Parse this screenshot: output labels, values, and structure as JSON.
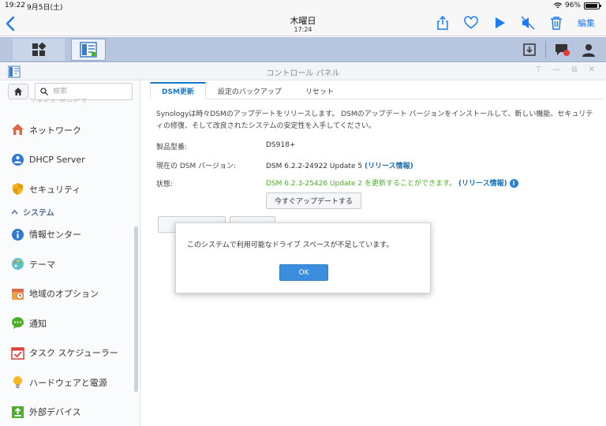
{
  "status_bar": {
    "time": "19:22",
    "date": "9月5日(土)",
    "battery": "96%"
  },
  "nav": {
    "title": "木曜日",
    "subtitle": "17:24",
    "edit_label": "編集"
  },
  "window": {
    "title": "コントロール パネル"
  },
  "sidebar": {
    "search_placeholder": "検索",
    "cut_item": "ファイル サービス",
    "items": [
      {
        "label": "ネットワーク",
        "icon": "house-network-icon"
      },
      {
        "label": "DHCP Server",
        "icon": "dhcp-icon"
      },
      {
        "label": "セキュリティ",
        "icon": "shield-icon"
      }
    ],
    "section": "システム",
    "system_items": [
      {
        "label": "情報センター",
        "icon": "info-icon"
      },
      {
        "label": "テーマ",
        "icon": "palette-icon"
      },
      {
        "label": "地域のオプション",
        "icon": "clock-calendar-icon"
      },
      {
        "label": "通知",
        "icon": "chat-bubble-icon"
      },
      {
        "label": "タスク スケジューラー",
        "icon": "calendar-check-icon"
      },
      {
        "label": "ハードウェアと電源",
        "icon": "lightbulb-icon"
      },
      {
        "label": "外部デバイス",
        "icon": "external-device-icon"
      }
    ]
  },
  "tabs": [
    "DSM更新",
    "設定のバックアップ",
    "リセット"
  ],
  "content": {
    "description": "Synologyは時々DSMのアップデートをリリースします。 DSMのアップデート バージョンをインストールして、新しい機能、セキュリティの修復、そして改良されたシステムの安定性を入手してください。",
    "model_label": "製品型番:",
    "model_value": "DS918+",
    "version_label": "現在の DSM バージョン:",
    "version_value": "DSM 6.2.2-24922 Update 5",
    "release_notes": "(リリース情報)",
    "status_label": "状態:",
    "status_value": "DSM 6.2.3-25426 Update 2 を更新することができます。",
    "update_button": "今すぐアップデートする"
  },
  "modal": {
    "message": "このシステムで利用可能なドライブ スペースが不足しています。",
    "ok": "OK"
  },
  "colors": {
    "accent": "#1a78c8",
    "ok_button": "#3b8ede",
    "status_green": "#4caf2a",
    "taskbar": "#b7c6de"
  }
}
